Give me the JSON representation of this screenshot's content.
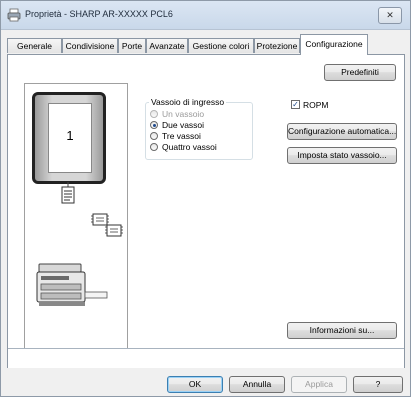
{
  "window": {
    "title": "Proprietà - SHARP AR-XXXXX PCL6",
    "close_glyph": "✕"
  },
  "tabs": [
    {
      "label": "Generale"
    },
    {
      "label": "Condivisione"
    },
    {
      "label": "Porte"
    },
    {
      "label": "Avanzate"
    },
    {
      "label": "Gestione colori"
    },
    {
      "label": "Protezione"
    },
    {
      "label": "Configurazione",
      "active": true
    }
  ],
  "panel": {
    "defaults_button": "Predefiniti",
    "preview": {
      "tray_number": "1"
    },
    "input_tray": {
      "title": "Vassoio di ingresso",
      "options": [
        {
          "label": "Un vassoio",
          "checked": false,
          "disabled": true
        },
        {
          "label": "Due vassoi",
          "checked": true,
          "disabled": false
        },
        {
          "label": "Tre vassoi",
          "checked": false,
          "disabled": false
        },
        {
          "label": "Quattro vassoi",
          "checked": false,
          "disabled": false
        }
      ]
    },
    "ropm": {
      "label": "ROPM",
      "checked": true,
      "check_glyph": "✓"
    },
    "auto_config_button": "Configurazione automatica...",
    "tray_status_button": "Imposta stato vassoio...",
    "about_button": "Informazioni su..."
  },
  "footer": {
    "ok": "OK",
    "cancel": "Annulla",
    "apply": "Applica",
    "help": "?"
  },
  "colors": {
    "accent": "#1f4a8c",
    "ok_border": "#3c7fb1"
  }
}
